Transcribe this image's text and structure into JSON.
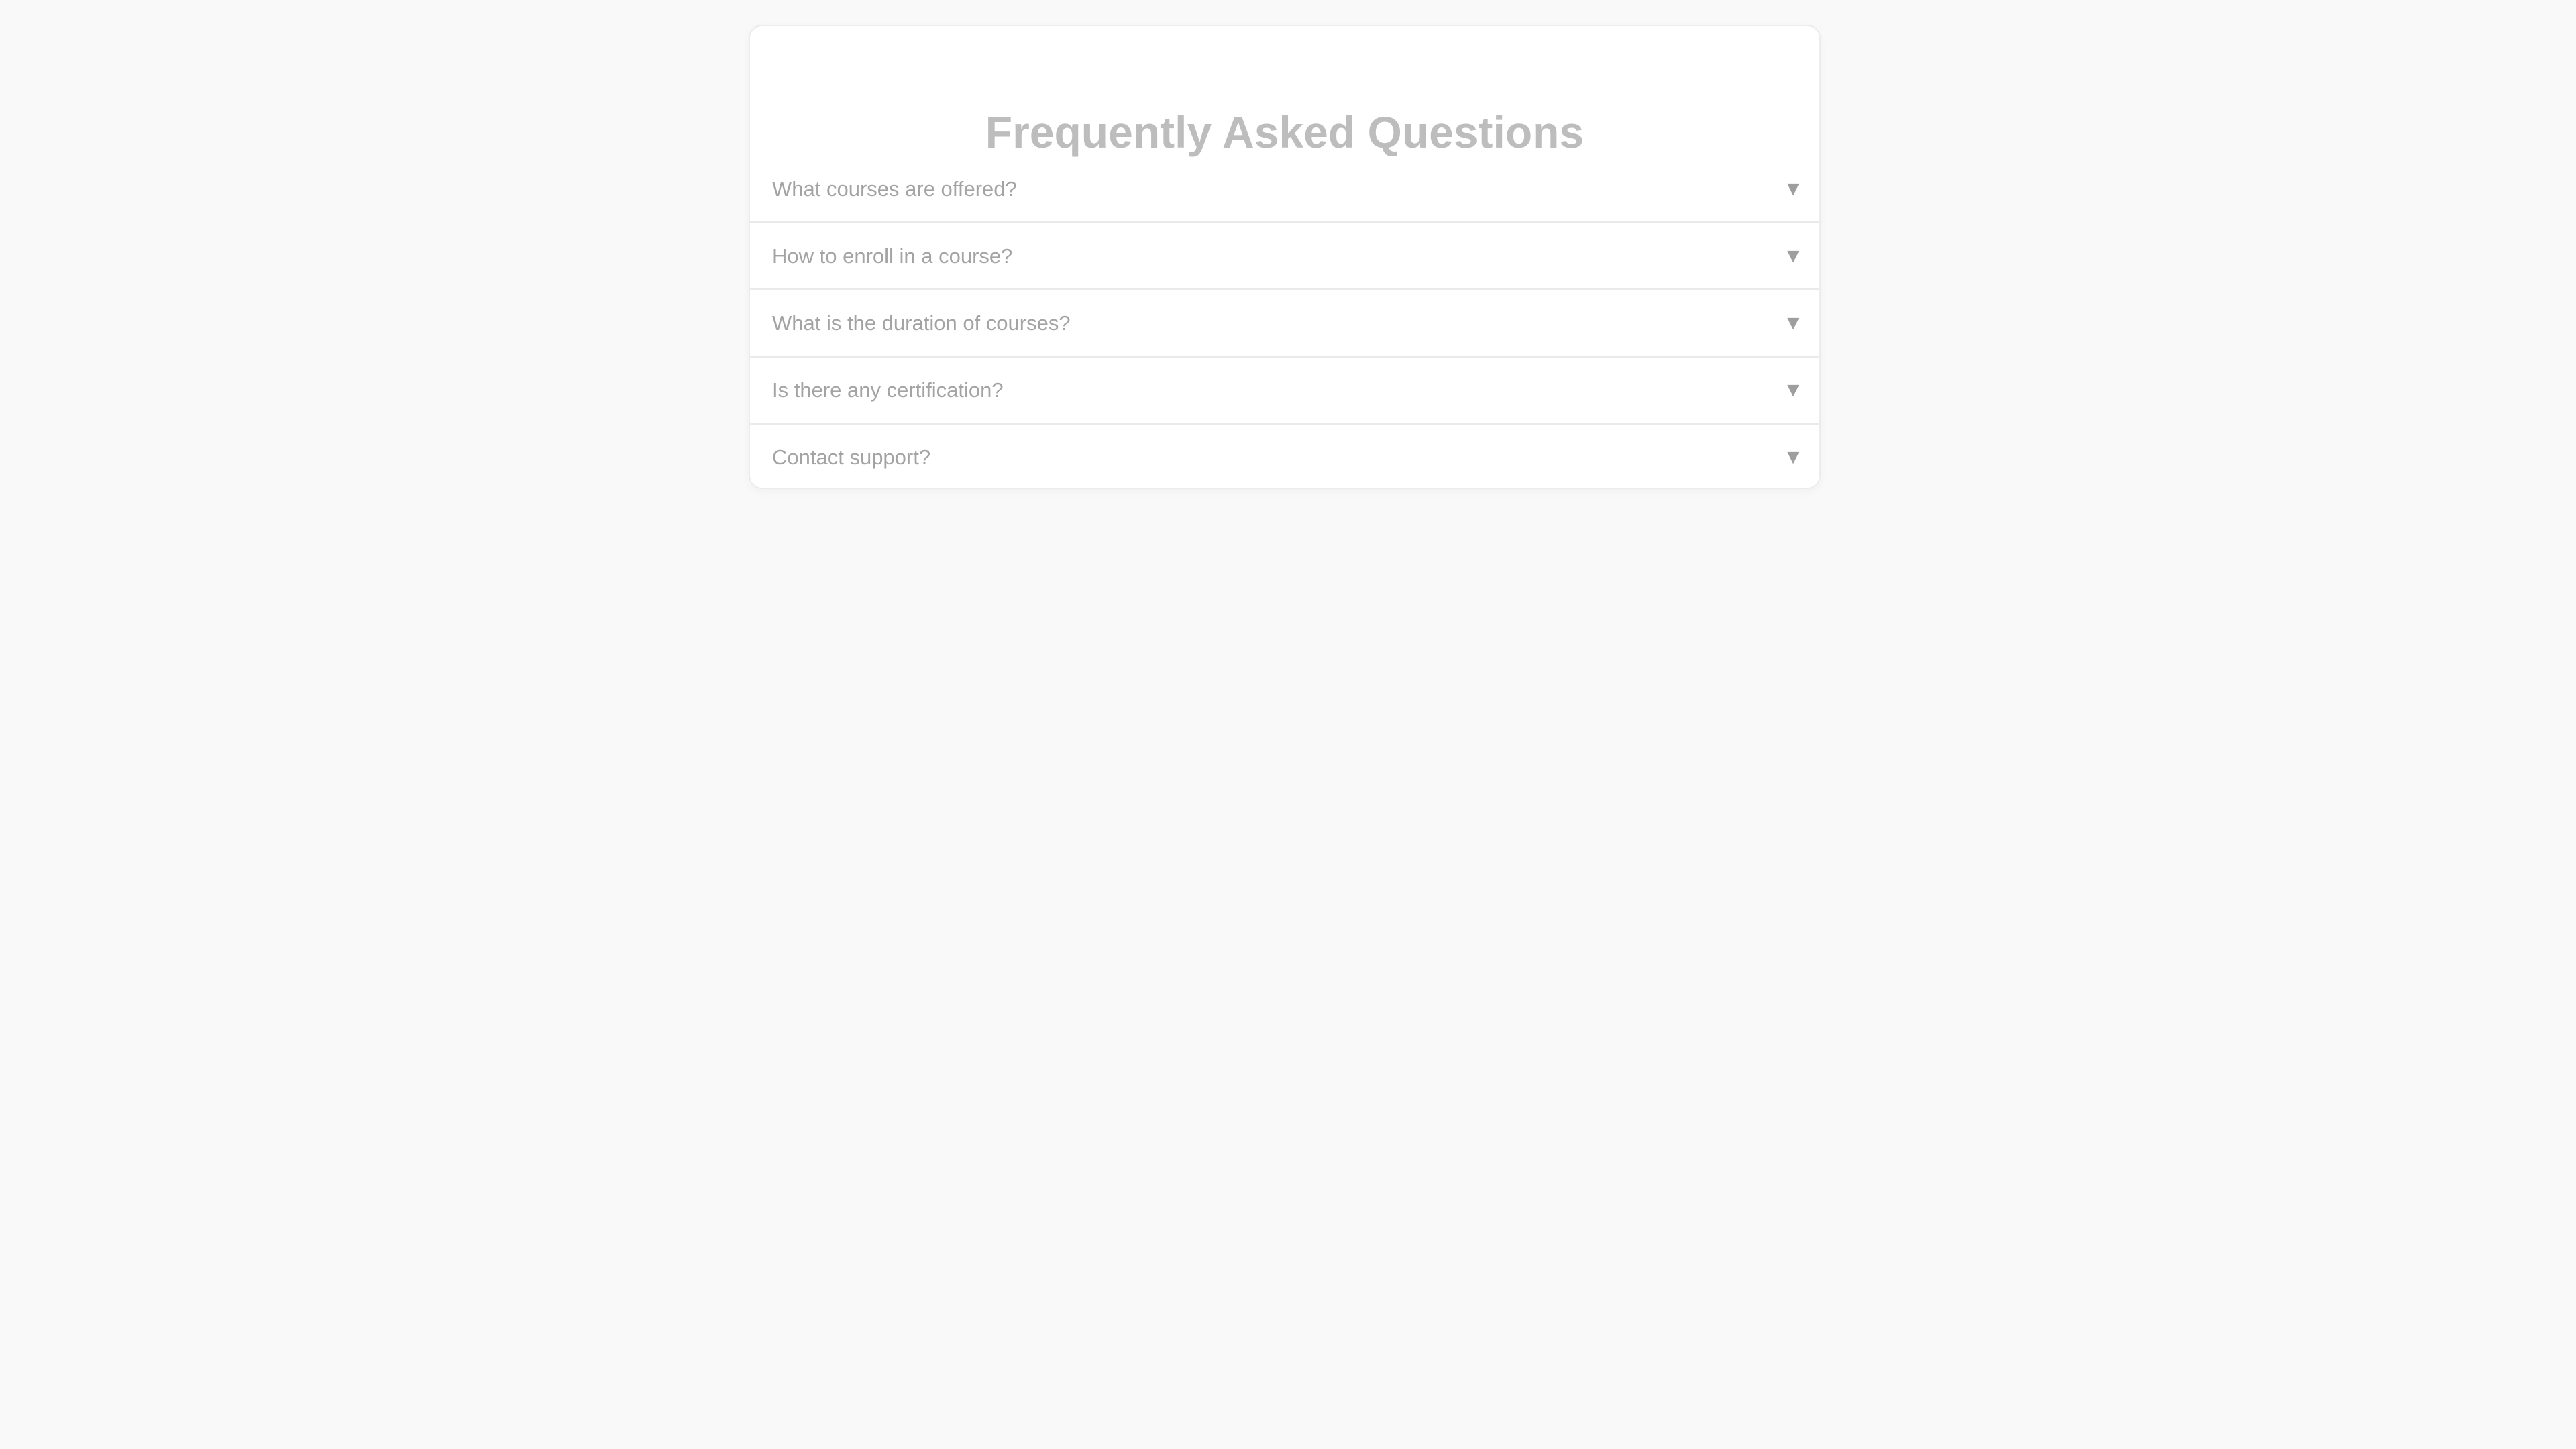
{
  "faq": {
    "title": "Frequently Asked Questions",
    "items": [
      {
        "question": "What courses are offered?",
        "icon": "chevron-down-icon",
        "glyph": "▼"
      },
      {
        "question": "How to enroll in a course?",
        "icon": "chevron-down-icon",
        "glyph": "▼"
      },
      {
        "question": "What is the duration of courses?",
        "icon": "chevron-down-icon",
        "glyph": "▼"
      },
      {
        "question": "Is there any certification?",
        "icon": "chevron-down-icon",
        "glyph": "▼"
      },
      {
        "question": "Contact support?",
        "icon": "chevron-down-icon",
        "glyph": "▼"
      }
    ]
  }
}
